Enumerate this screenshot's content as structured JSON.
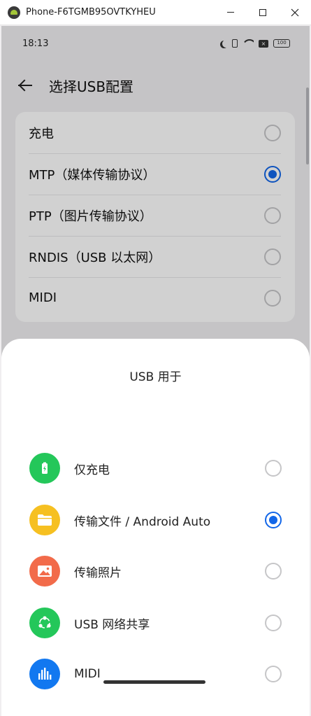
{
  "window": {
    "title": "Phone-F6TGMB95OVTKYHEU"
  },
  "status_bar": {
    "time": "18:13",
    "battery": "100"
  },
  "header": {
    "title": "选择USB配置"
  },
  "usb_config": {
    "items": [
      {
        "label": "充电",
        "checked": false
      },
      {
        "label": "MTP（媒体传输协议）",
        "checked": true
      },
      {
        "label": "PTP（图片传输协议）",
        "checked": false
      },
      {
        "label": "RNDIS（USB 以太网）",
        "checked": false
      },
      {
        "label": "MIDI",
        "checked": false
      }
    ]
  },
  "sheet": {
    "title": "USB 用于",
    "items": [
      {
        "label": "仅充电",
        "icon": "battery-charge-icon",
        "color": "#24c75a",
        "checked": false
      },
      {
        "label": "传输文件 / Android Auto",
        "icon": "folder-icon",
        "color": "#f6c021",
        "checked": true
      },
      {
        "label": "传输照片",
        "icon": "photo-icon",
        "color": "#f26b4a",
        "checked": false
      },
      {
        "label": "USB 网络共享",
        "icon": "share-network-icon",
        "color": "#24c75a",
        "checked": false
      },
      {
        "label": "MIDI",
        "icon": "equalizer-icon",
        "color": "#1278f0",
        "checked": false
      }
    ]
  },
  "colors": {
    "accent": "#1266e8"
  }
}
